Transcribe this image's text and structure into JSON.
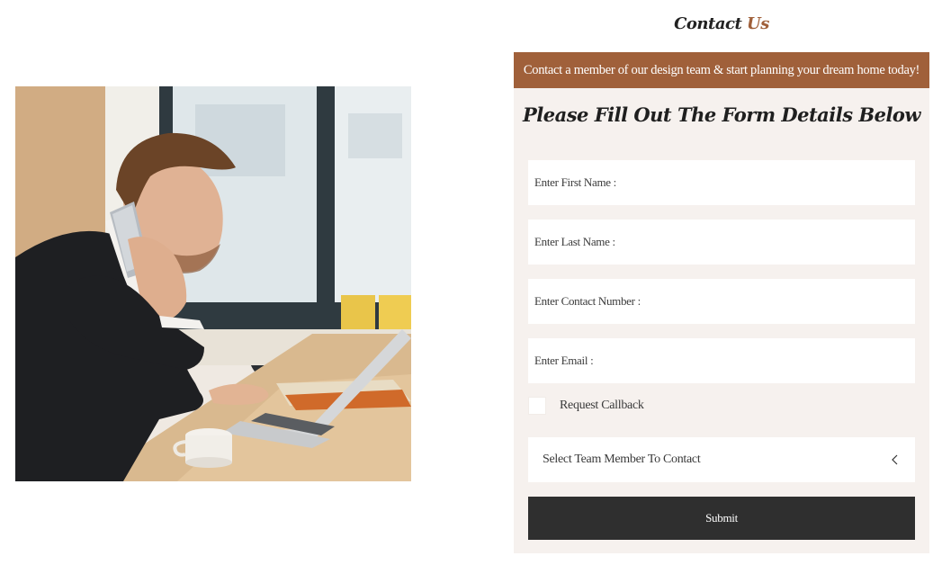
{
  "header": {
    "title_part1": "Contact",
    "title_part2": "Us"
  },
  "banner": {
    "text": "Contact a member of our design team & start planning your dream home today!"
  },
  "form": {
    "title": "Please Fill Out The Form Details Below",
    "fields": [
      {
        "placeholder": "Enter First Name :",
        "value": ""
      },
      {
        "placeholder": "Enter Last Name :",
        "value": ""
      },
      {
        "placeholder": "Enter Contact Number :",
        "value": ""
      },
      {
        "placeholder": "Enter Email :",
        "value": ""
      }
    ],
    "callback_label": "Request Callback",
    "callback_checked": false,
    "select_value": "Select Team Member To Contact",
    "submit_label": "Submit"
  },
  "colors": {
    "accent": "#a0603a",
    "panel_background": "#f6f1ee",
    "button_background": "#2f2f2f"
  },
  "icons": {
    "select": "chevron-left-icon"
  }
}
